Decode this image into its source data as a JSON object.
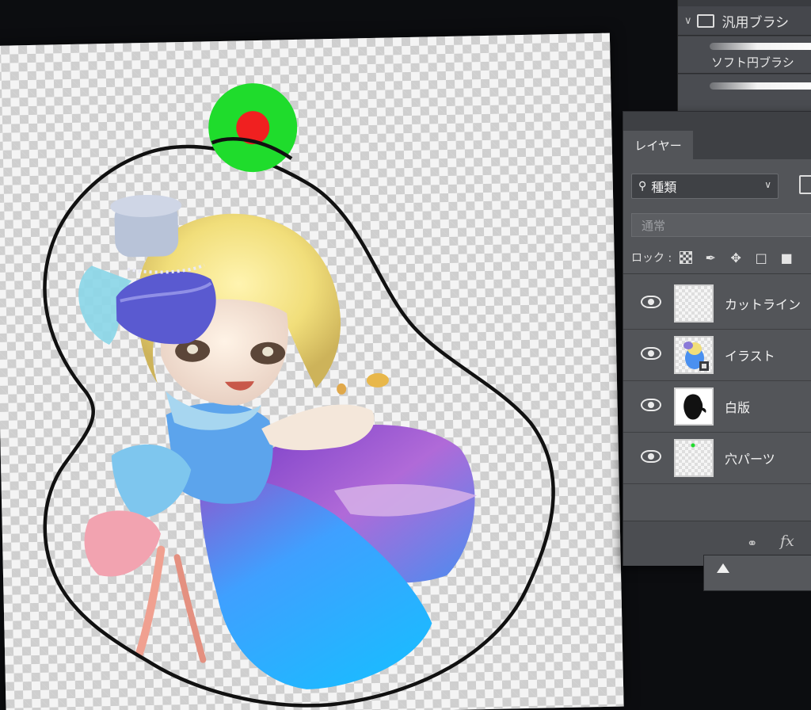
{
  "brush_panel": {
    "folder_label": "汎用ブラシ",
    "items": [
      {
        "label": "ソフト円ブラシ"
      },
      {
        "label": ""
      }
    ]
  },
  "layers_panel": {
    "tab_label": "レイヤー",
    "kind_filter": "種類",
    "blend_mode": "通常",
    "lock_label": "ロック :",
    "layers": [
      {
        "name": "カットライン",
        "visible": true
      },
      {
        "name": "イラスト",
        "visible": true
      },
      {
        "name": "白版",
        "visible": true
      },
      {
        "name": "穴パーツ",
        "visible": true
      }
    ]
  },
  "colors": {
    "hole_outer": "#1fdc2c",
    "hole_inner": "#f02020",
    "cutline": "#111111",
    "panel_bg": "#535559"
  }
}
